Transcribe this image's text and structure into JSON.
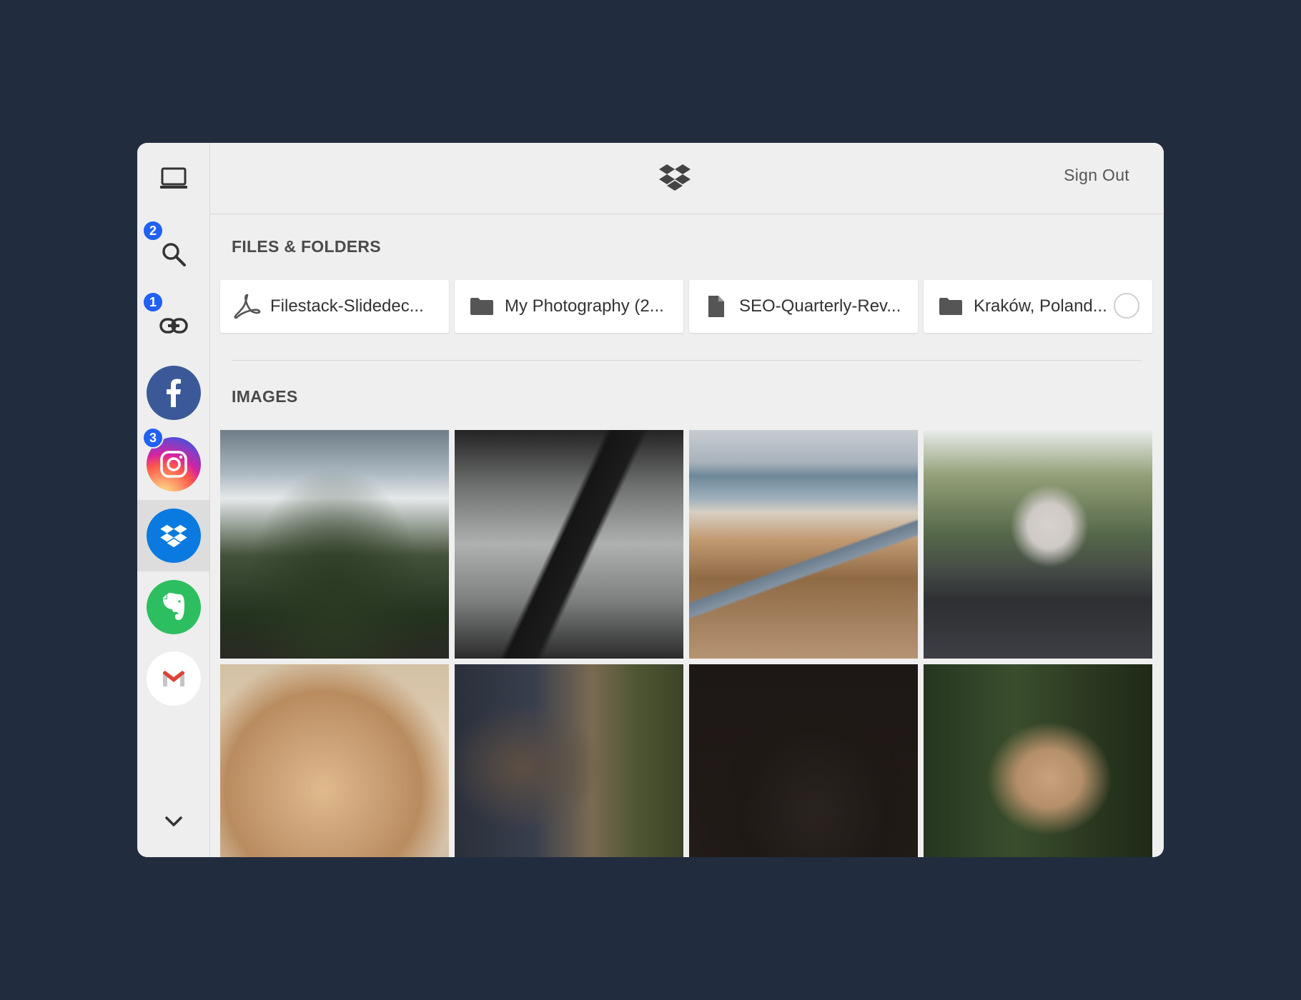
{
  "sidebar": {
    "items": [
      {
        "name": "my-device",
        "icon": "laptop-icon",
        "badge": ""
      },
      {
        "name": "image-search",
        "icon": "search-icon",
        "badge": "2"
      },
      {
        "name": "link-url",
        "icon": "link-icon",
        "badge": "1"
      },
      {
        "name": "facebook",
        "icon": "facebook-icon",
        "badge": "",
        "color": "#3b5998"
      },
      {
        "name": "instagram",
        "icon": "instagram-icon",
        "badge": "3"
      },
      {
        "name": "dropbox",
        "icon": "dropbox-icon",
        "badge": "",
        "color": "#0a7ae0",
        "active": true
      },
      {
        "name": "evernote",
        "icon": "evernote-icon",
        "badge": "",
        "color": "#2dbe60"
      },
      {
        "name": "gmail",
        "icon": "gmail-icon",
        "badge": ""
      }
    ],
    "more_icon": "chevron-down-icon"
  },
  "header": {
    "logo_icon": "dropbox-icon",
    "signout_label": "Sign Out"
  },
  "files_section": {
    "title": "FILES & FOLDERS",
    "items": [
      {
        "name": "Filestack-Slidedec...",
        "icon": "pdf-icon"
      },
      {
        "name": "My Photography (2...",
        "icon": "folder-icon"
      },
      {
        "name": "SEO-Quarterly-Rev...",
        "icon": "document-icon"
      },
      {
        "name": "Kraków, Poland...",
        "icon": "folder-icon",
        "selectable": true
      }
    ]
  },
  "images_section": {
    "title": "IMAGES",
    "count": 8
  },
  "colors": {
    "background": "#222c3f",
    "badge": "#2160f3",
    "panel": "#efefef"
  }
}
